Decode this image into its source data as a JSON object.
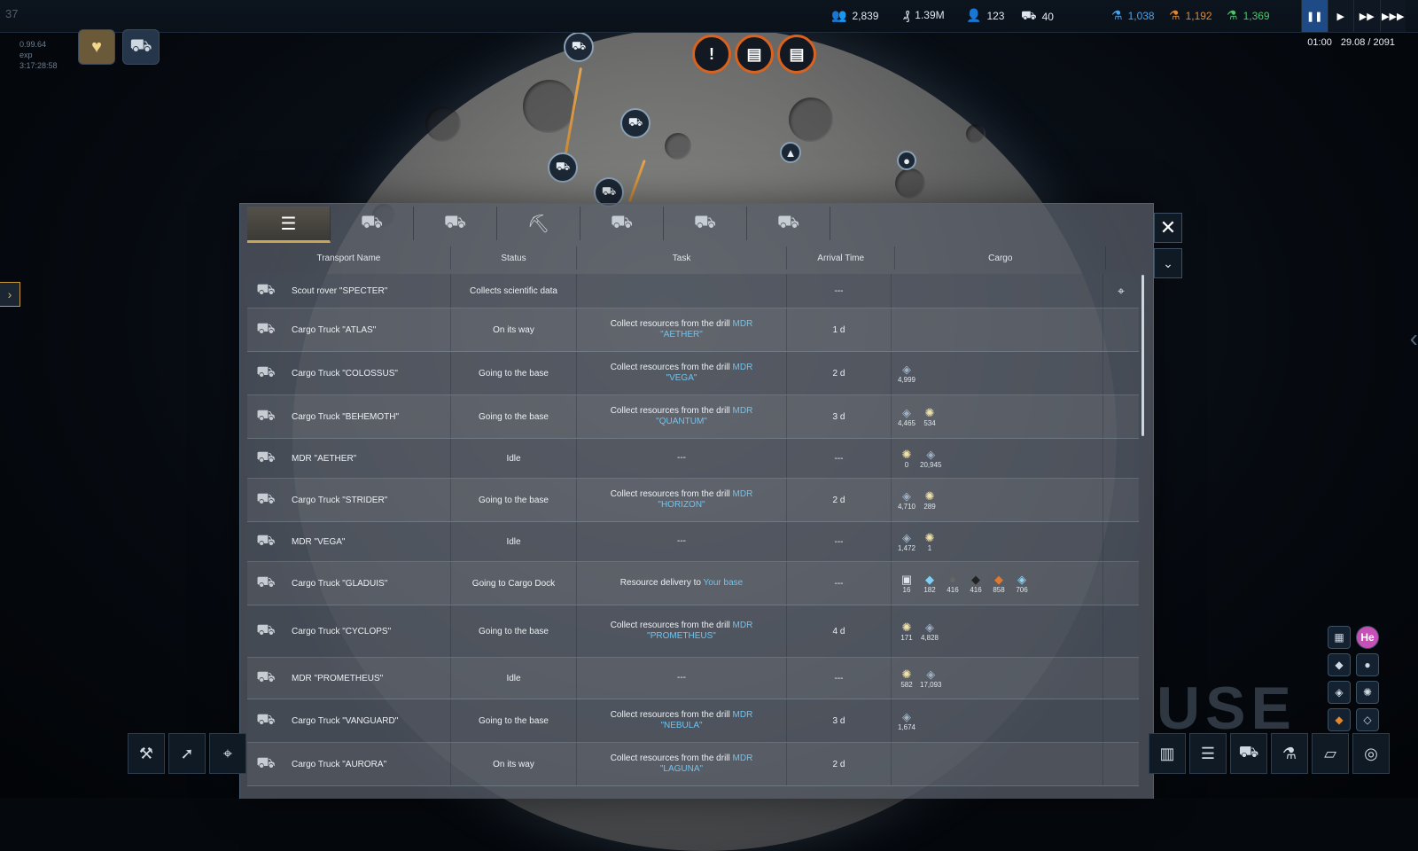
{
  "top_left": {
    "number": "37",
    "info_lines": [
      "0.99.64",
      "exp",
      "3:17:28:58"
    ]
  },
  "resources": [
    {
      "icon": "colonists-icon",
      "value": "2,839"
    },
    {
      "icon": "money-icon",
      "value": "1.39M"
    },
    {
      "icon": "people-icon",
      "value": "123"
    },
    {
      "icon": "vehicles-icon",
      "value": "40"
    },
    {
      "icon": "flask-blue-icon",
      "value": "1,038",
      "color": "#4aa3e8"
    },
    {
      "icon": "flask-orange-icon",
      "value": "1,192",
      "color": "#e0872f"
    },
    {
      "icon": "flask-green-icon",
      "value": "1,369",
      "color": "#4cc56a"
    }
  ],
  "clock": {
    "time": "01:00",
    "date": "29.08 / 2091"
  },
  "panel": {
    "headers": {
      "name": "Transport Name",
      "status": "Status",
      "task": "Task",
      "arrival": "Arrival Time",
      "cargo": "Cargo"
    },
    "rows": [
      {
        "name": "Scout rover \"SPECTER\"",
        "status": "Collects scientific data",
        "task_text": "",
        "task_link": "",
        "arrival": "---",
        "cargo": [],
        "locate": true
      },
      {
        "name": "Cargo Truck \"ATLAS\"",
        "status": "On its way",
        "task_text": "Collect resources from the drill ",
        "task_link": "MDR \"AETHER\"",
        "arrival": "1 d",
        "cargo": []
      },
      {
        "name": "Cargo Truck \"COLOSSUS\"",
        "status": "Going to the base",
        "task_text": "Collect resources from the drill ",
        "task_link": "MDR \"VEGA\"",
        "arrival": "2 d",
        "cargo": [
          {
            "icon": "ore-icon",
            "value": "4,999"
          }
        ]
      },
      {
        "name": "Cargo Truck \"BEHEMOTH\"",
        "status": "Going to the base",
        "task_text": "Collect resources from the drill ",
        "task_link": "MDR \"QUANTUM\"",
        "arrival": "3 d",
        "cargo": [
          {
            "icon": "ore-icon",
            "value": "4,465"
          },
          {
            "icon": "crystal-icon",
            "value": "534"
          }
        ]
      },
      {
        "name": "MDR \"AETHER\"",
        "status": "Idle",
        "task_text": "---",
        "task_link": "",
        "arrival": "---",
        "cargo": [
          {
            "icon": "crystal-icon",
            "value": "0"
          },
          {
            "icon": "ore-icon",
            "value": "20,945"
          }
        ]
      },
      {
        "name": "Cargo Truck \"STRIDER\"",
        "status": "Going to the base",
        "task_text": "Collect resources from the drill ",
        "task_link": "MDR \"HORIZON\"",
        "arrival": "2 d",
        "cargo": [
          {
            "icon": "ore-icon",
            "value": "4,710"
          },
          {
            "icon": "crystal-icon",
            "value": "289"
          }
        ]
      },
      {
        "name": "MDR \"VEGA\"",
        "status": "Idle",
        "task_text": "---",
        "task_link": "",
        "arrival": "---",
        "cargo": [
          {
            "icon": "ore-icon",
            "value": "1,472"
          },
          {
            "icon": "crystal-icon",
            "value": "1"
          }
        ]
      },
      {
        "name": "Cargo Truck \"GLADUIS\"",
        "status": "Going to Cargo Dock",
        "task_text": "Resource delivery to ",
        "task_link": "Your base",
        "arrival": "---",
        "cargo": [
          {
            "icon": "container-icon",
            "value": "16"
          },
          {
            "icon": "ice-icon",
            "value": "182"
          },
          {
            "icon": "rock-icon",
            "value": "416"
          },
          {
            "icon": "coal-icon",
            "value": "416"
          },
          {
            "icon": "copper-icon",
            "value": "858"
          },
          {
            "icon": "blue-ore-icon",
            "value": "706"
          }
        ]
      },
      {
        "name": "Cargo Truck \"CYCLOPS\"",
        "status": "Going to the base",
        "task_text": "Collect resources from the drill ",
        "task_link": "MDR \"PROMETHEUS\"",
        "arrival": "4 d",
        "cargo": [
          {
            "icon": "crystal-icon",
            "value": "171"
          },
          {
            "icon": "ore-icon",
            "value": "4,828"
          }
        ]
      },
      {
        "name": "MDR \"PROMETHEUS\"",
        "status": "Idle",
        "task_text": "---",
        "task_link": "",
        "arrival": "---",
        "cargo": [
          {
            "icon": "crystal-icon",
            "value": "582"
          },
          {
            "icon": "ore-icon",
            "value": "17,093"
          }
        ]
      },
      {
        "name": "Cargo Truck \"VANGUARD\"",
        "status": "Going to the base",
        "task_text": "Collect resources from the drill ",
        "task_link": "MDR \"NEBULA\"",
        "arrival": "3 d",
        "cargo": [
          {
            "icon": "ore-icon",
            "value": "1,674"
          }
        ]
      },
      {
        "name": "Cargo Truck \"AURORA\"",
        "status": "On its way",
        "task_text": "Collect resources from the drill ",
        "task_link": "MDR \"LAGUNA\"",
        "arrival": "2 d",
        "cargo": []
      }
    ]
  },
  "pause_label": "USE",
  "side_resources": [
    {
      "icon": "he-icon",
      "label": "He"
    }
  ]
}
